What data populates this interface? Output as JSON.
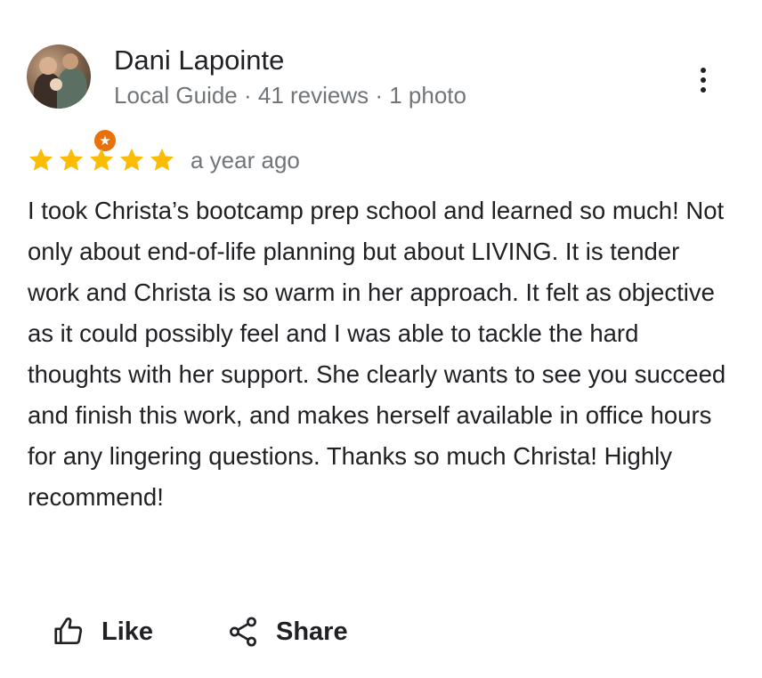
{
  "reviewer": {
    "name": "Dani Lapointe",
    "meta": "Local Guide · 41 reviews · 1 photo",
    "avatar_icon": "profile-photo",
    "badge_icon": "local-guide-star-icon"
  },
  "rating": {
    "stars": 5,
    "max_stars": 5,
    "time": "a year ago",
    "star_color": "#FBBC04"
  },
  "review": {
    "text": "I took Christa’s bootcamp prep school and learned so much! Not only about end-of-life planning but about LIVING. It is tender work and Christa is so warm in her approach. It felt as objective as it could possibly feel and I was able to tackle the hard thoughts with her support. She clearly wants to see you succeed and finish this work, and makes herself available in office hours for any lingering questions. Thanks so much Christa! Highly recommend!"
  },
  "actions": {
    "like_label": "Like",
    "like_icon": "thumbs-up-icon",
    "share_label": "Share",
    "share_icon": "share-icon",
    "more_icon": "more-vert-icon"
  },
  "colors": {
    "text_primary": "#202124",
    "text_secondary": "#70757a",
    "badge": "#E8710A"
  }
}
